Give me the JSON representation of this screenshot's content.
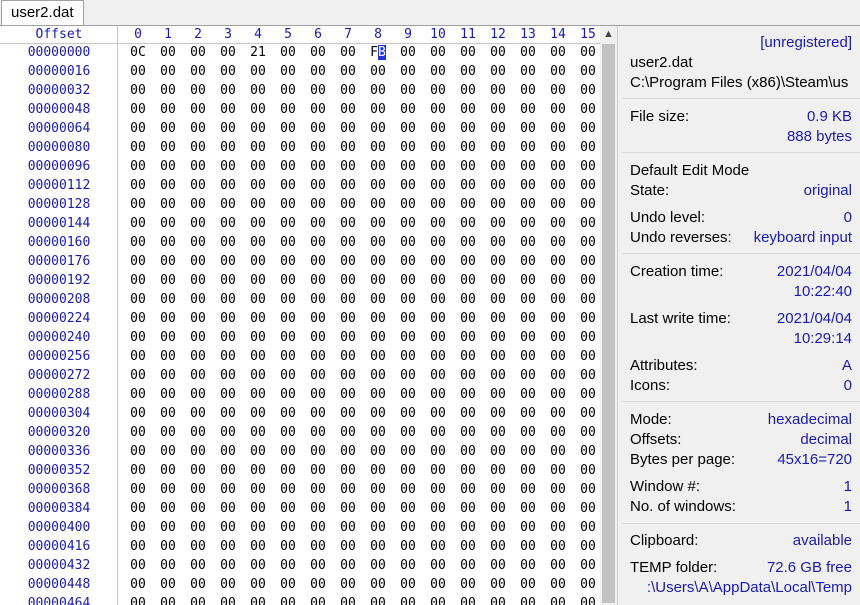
{
  "tab": {
    "label": "user2.dat"
  },
  "hex": {
    "offset_header": "Offset",
    "column_headers": [
      "0",
      "1",
      "2",
      "3",
      "4",
      "5",
      "6",
      "7",
      "8",
      "9",
      "10",
      "11",
      "12",
      "13",
      "14",
      "15"
    ],
    "offsets": [
      "00000000",
      "00000016",
      "00000032",
      "00000048",
      "00000064",
      "00000080",
      "00000096",
      "00000112",
      "00000128",
      "00000144",
      "00000160",
      "00000176",
      "00000192",
      "00000208",
      "00000224",
      "00000240",
      "00000256",
      "00000272",
      "00000288",
      "00000304",
      "00000320",
      "00000336",
      "00000352",
      "00000368",
      "00000384",
      "00000400",
      "00000416",
      "00000432",
      "00000448",
      "00000464"
    ],
    "first_row_bytes": [
      "0C",
      "00",
      "00",
      "00",
      "21",
      "00",
      "00",
      "00",
      "FB",
      "00",
      "00",
      "00",
      "00",
      "00",
      "00",
      "00"
    ],
    "fill_byte": "00",
    "cursor": {
      "row": 0,
      "col": 8
    }
  },
  "scrollbar": {
    "up_arrow": "▲"
  },
  "info": {
    "status": "[unregistered]",
    "filename": "user2.dat",
    "path": "C:\\Program Files (x86)\\Steam\\us",
    "file_size_label": "File size:",
    "file_size_kb": "0.9 KB",
    "file_size_bytes": "888 bytes",
    "edit_mode": "Default Edit Mode",
    "state_label": "State:",
    "state_value": "original",
    "undo_level_label": "Undo level:",
    "undo_level_value": "0",
    "undo_reverses_label": "Undo reverses:",
    "undo_reverses_value": "keyboard input",
    "creation_label": "Creation time:",
    "creation_date": "2021/04/04",
    "creation_time": "10:22:40",
    "lastwrite_label": "Last write time:",
    "lastwrite_date": "2021/04/04",
    "lastwrite_time": "10:29:14",
    "attributes_label": "Attributes:",
    "attributes_value": "A",
    "icons_label": "Icons:",
    "icons_value": "0",
    "mode_label": "Mode:",
    "mode_value": "hexadecimal",
    "offsets_label": "Offsets:",
    "offsets_value": "decimal",
    "bpp_label": "Bytes per page:",
    "bpp_value": "45x16=720",
    "window_label": "Window #:",
    "window_value": "1",
    "nwin_label": "No. of windows:",
    "nwin_value": "1",
    "clipboard_label": "Clipboard:",
    "clipboard_value": "available",
    "temp_label": "TEMP folder:",
    "temp_value": "72.6 GB free",
    "temp_path": ":\\Users\\A\\AppData\\Local\\Temp"
  }
}
